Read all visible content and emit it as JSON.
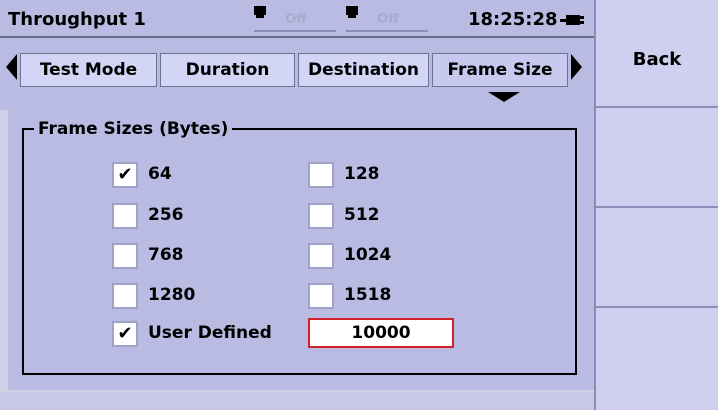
{
  "header": {
    "title": "Throughput 1",
    "port1_status": "Off",
    "port2_status": "Off",
    "clock": "18:25:28",
    "icons": [
      "port-icon",
      "port-icon",
      "battery-plug-icon"
    ]
  },
  "tabs": [
    {
      "label": "Test Mode"
    },
    {
      "label": "Duration"
    },
    {
      "label": "Destination"
    },
    {
      "label": "Frame Size",
      "active": true
    }
  ],
  "group": {
    "legend": "Frame Sizes (Bytes)",
    "options": [
      {
        "label": "64",
        "checked": true
      },
      {
        "label": "128",
        "checked": false
      },
      {
        "label": "256",
        "checked": false
      },
      {
        "label": "512",
        "checked": false
      },
      {
        "label": "768",
        "checked": false
      },
      {
        "label": "1024",
        "checked": false
      },
      {
        "label": "1280",
        "checked": false
      },
      {
        "label": "1518",
        "checked": false
      },
      {
        "label": "User Defined",
        "checked": true
      }
    ],
    "user_defined_value": "10000",
    "check_glyph": "✔"
  },
  "softkeys": {
    "back_label": "Back"
  },
  "colors": {
    "panel": "#b9bbe2",
    "entry_border": "#d0202a"
  }
}
